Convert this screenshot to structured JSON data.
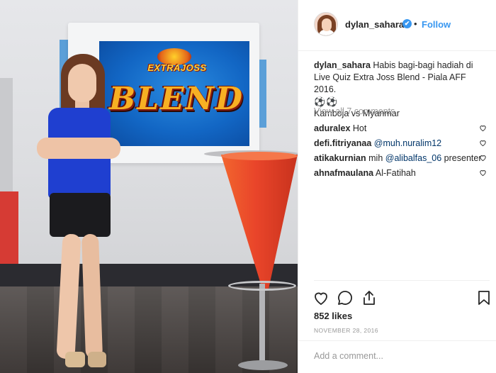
{
  "post": {
    "username": "dylan_sahara",
    "verified_mark": "✔",
    "separator": "•",
    "follow_label": "Follow",
    "caption_user": "dylan_sahara",
    "caption_text": "Habis bagi-bagi hadiah di Live Quiz Extra Joss Blend - Piala AFF 2016.",
    "caption_emoji": "⚽⚽",
    "caption_line2": "Kamboja vs Myanmar",
    "view_all_comments": "View all 7 comments",
    "comments": [
      {
        "user": "aduralex",
        "text": "Hot",
        "mention": ""
      },
      {
        "user": "defi.fitriyanaa",
        "text": "",
        "mention": "@muh.nuralim12"
      },
      {
        "user": "atikakurnian",
        "text": "mih",
        "mention": "@alibalfas_06",
        "after": "presenter"
      },
      {
        "user": "ahnafmaulana",
        "text": "Al-Fatihah",
        "mention": ""
      }
    ],
    "likes": "852 likes",
    "date": "NOVEMBER 28, 2016",
    "add_comment_placeholder": "Add a comment..."
  },
  "photo": {
    "screen_logo_top": "EXTRAJOSS",
    "screen_logo_main": "BLEND"
  },
  "icons": {
    "heart": "heart-icon",
    "comment": "comment-icon",
    "share": "share-icon",
    "bookmark": "bookmark-icon",
    "verified": "verified-badge-icon"
  },
  "colors": {
    "link_blue": "#3897f0",
    "mention_blue": "#003569",
    "muted_gray": "#999999"
  }
}
